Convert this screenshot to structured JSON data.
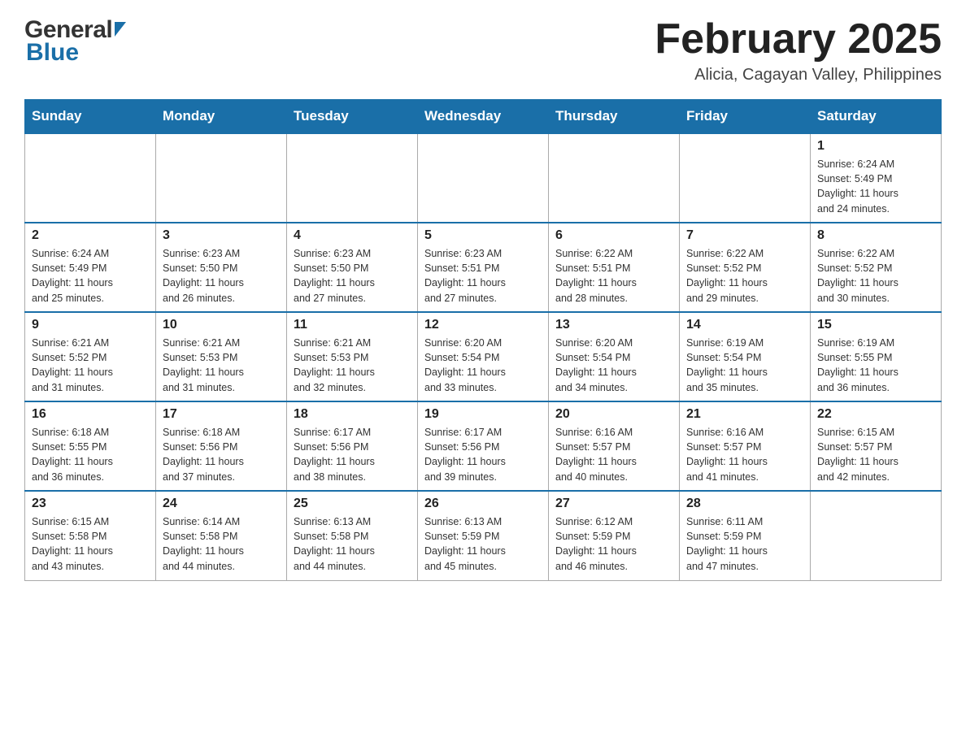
{
  "header": {
    "title": "February 2025",
    "subtitle": "Alicia, Cagayan Valley, Philippines"
  },
  "logo": {
    "general": "General",
    "blue": "Blue"
  },
  "days_of_week": [
    "Sunday",
    "Monday",
    "Tuesday",
    "Wednesday",
    "Thursday",
    "Friday",
    "Saturday"
  ],
  "weeks": [
    [
      {
        "day": "",
        "info": ""
      },
      {
        "day": "",
        "info": ""
      },
      {
        "day": "",
        "info": ""
      },
      {
        "day": "",
        "info": ""
      },
      {
        "day": "",
        "info": ""
      },
      {
        "day": "",
        "info": ""
      },
      {
        "day": "1",
        "info": "Sunrise: 6:24 AM\nSunset: 5:49 PM\nDaylight: 11 hours\nand 24 minutes."
      }
    ],
    [
      {
        "day": "2",
        "info": "Sunrise: 6:24 AM\nSunset: 5:49 PM\nDaylight: 11 hours\nand 25 minutes."
      },
      {
        "day": "3",
        "info": "Sunrise: 6:23 AM\nSunset: 5:50 PM\nDaylight: 11 hours\nand 26 minutes."
      },
      {
        "day": "4",
        "info": "Sunrise: 6:23 AM\nSunset: 5:50 PM\nDaylight: 11 hours\nand 27 minutes."
      },
      {
        "day": "5",
        "info": "Sunrise: 6:23 AM\nSunset: 5:51 PM\nDaylight: 11 hours\nand 27 minutes."
      },
      {
        "day": "6",
        "info": "Sunrise: 6:22 AM\nSunset: 5:51 PM\nDaylight: 11 hours\nand 28 minutes."
      },
      {
        "day": "7",
        "info": "Sunrise: 6:22 AM\nSunset: 5:52 PM\nDaylight: 11 hours\nand 29 minutes."
      },
      {
        "day": "8",
        "info": "Sunrise: 6:22 AM\nSunset: 5:52 PM\nDaylight: 11 hours\nand 30 minutes."
      }
    ],
    [
      {
        "day": "9",
        "info": "Sunrise: 6:21 AM\nSunset: 5:52 PM\nDaylight: 11 hours\nand 31 minutes."
      },
      {
        "day": "10",
        "info": "Sunrise: 6:21 AM\nSunset: 5:53 PM\nDaylight: 11 hours\nand 31 minutes."
      },
      {
        "day": "11",
        "info": "Sunrise: 6:21 AM\nSunset: 5:53 PM\nDaylight: 11 hours\nand 32 minutes."
      },
      {
        "day": "12",
        "info": "Sunrise: 6:20 AM\nSunset: 5:54 PM\nDaylight: 11 hours\nand 33 minutes."
      },
      {
        "day": "13",
        "info": "Sunrise: 6:20 AM\nSunset: 5:54 PM\nDaylight: 11 hours\nand 34 minutes."
      },
      {
        "day": "14",
        "info": "Sunrise: 6:19 AM\nSunset: 5:54 PM\nDaylight: 11 hours\nand 35 minutes."
      },
      {
        "day": "15",
        "info": "Sunrise: 6:19 AM\nSunset: 5:55 PM\nDaylight: 11 hours\nand 36 minutes."
      }
    ],
    [
      {
        "day": "16",
        "info": "Sunrise: 6:18 AM\nSunset: 5:55 PM\nDaylight: 11 hours\nand 36 minutes."
      },
      {
        "day": "17",
        "info": "Sunrise: 6:18 AM\nSunset: 5:56 PM\nDaylight: 11 hours\nand 37 minutes."
      },
      {
        "day": "18",
        "info": "Sunrise: 6:17 AM\nSunset: 5:56 PM\nDaylight: 11 hours\nand 38 minutes."
      },
      {
        "day": "19",
        "info": "Sunrise: 6:17 AM\nSunset: 5:56 PM\nDaylight: 11 hours\nand 39 minutes."
      },
      {
        "day": "20",
        "info": "Sunrise: 6:16 AM\nSunset: 5:57 PM\nDaylight: 11 hours\nand 40 minutes."
      },
      {
        "day": "21",
        "info": "Sunrise: 6:16 AM\nSunset: 5:57 PM\nDaylight: 11 hours\nand 41 minutes."
      },
      {
        "day": "22",
        "info": "Sunrise: 6:15 AM\nSunset: 5:57 PM\nDaylight: 11 hours\nand 42 minutes."
      }
    ],
    [
      {
        "day": "23",
        "info": "Sunrise: 6:15 AM\nSunset: 5:58 PM\nDaylight: 11 hours\nand 43 minutes."
      },
      {
        "day": "24",
        "info": "Sunrise: 6:14 AM\nSunset: 5:58 PM\nDaylight: 11 hours\nand 44 minutes."
      },
      {
        "day": "25",
        "info": "Sunrise: 6:13 AM\nSunset: 5:58 PM\nDaylight: 11 hours\nand 44 minutes."
      },
      {
        "day": "26",
        "info": "Sunrise: 6:13 AM\nSunset: 5:59 PM\nDaylight: 11 hours\nand 45 minutes."
      },
      {
        "day": "27",
        "info": "Sunrise: 6:12 AM\nSunset: 5:59 PM\nDaylight: 11 hours\nand 46 minutes."
      },
      {
        "day": "28",
        "info": "Sunrise: 6:11 AM\nSunset: 5:59 PM\nDaylight: 11 hours\nand 47 minutes."
      },
      {
        "day": "",
        "info": ""
      }
    ]
  ]
}
